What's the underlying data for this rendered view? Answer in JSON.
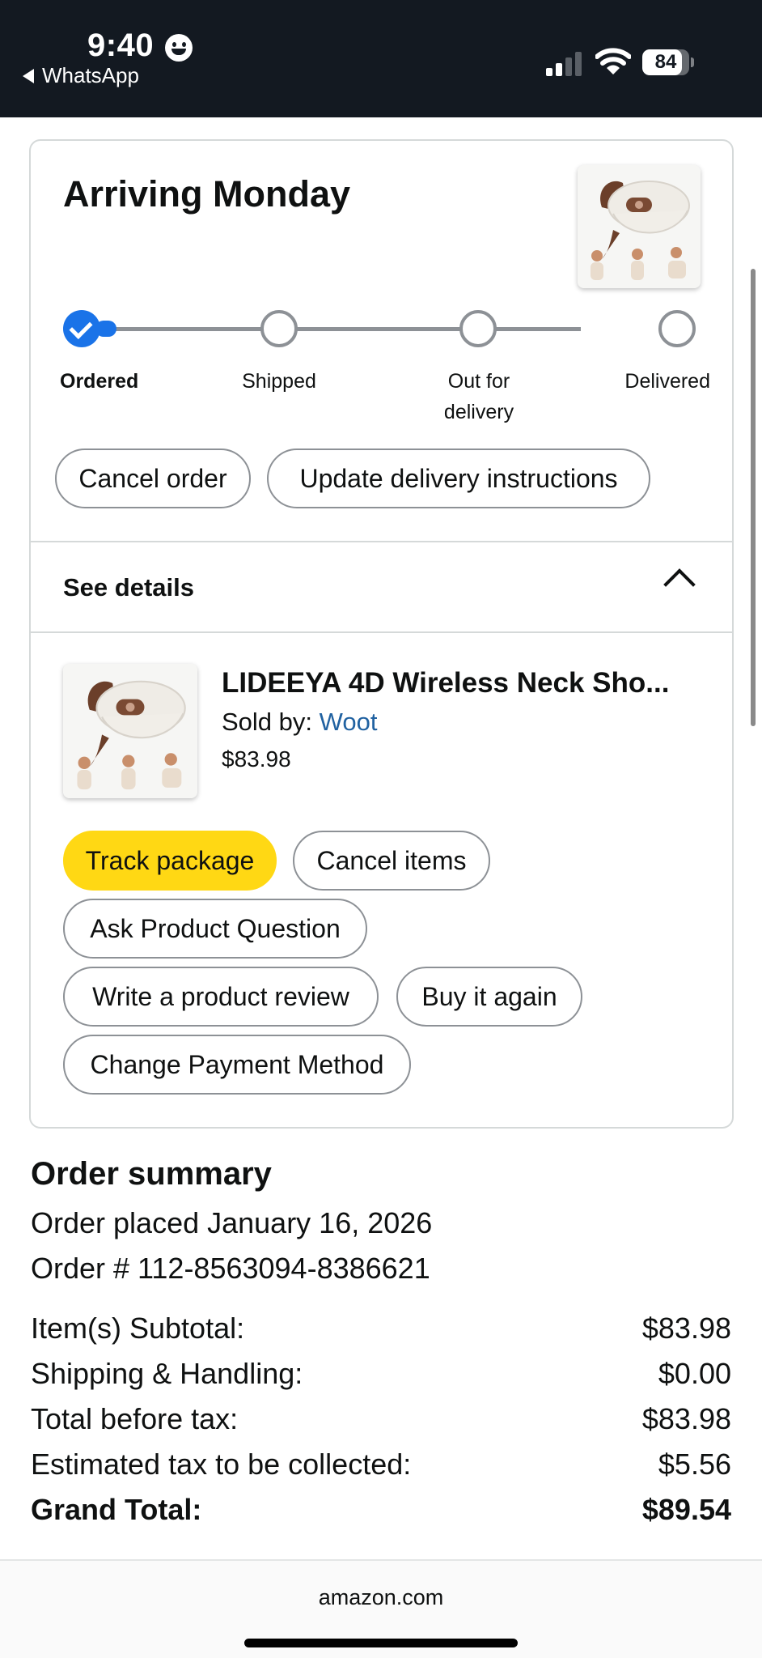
{
  "status_bar": {
    "time": "9:40",
    "back_app": "WhatsApp",
    "battery_percent": "84",
    "battery_level": 0.84,
    "signal_bars_active": 2,
    "icons": [
      "smiley-face-icon",
      "back-arrow-icon",
      "cellular-signal-icon",
      "wifi-icon",
      "battery-icon"
    ]
  },
  "shipment": {
    "title": "Arriving Monday",
    "steps": [
      {
        "label": "Ordered",
        "status": "complete"
      },
      {
        "label": "Shipped",
        "status": "pending"
      },
      {
        "label": "Out for delivery",
        "status": "pending"
      },
      {
        "label": "Delivered",
        "status": "pending"
      }
    ],
    "actions": {
      "cancel_order": "Cancel order",
      "update_instructions": "Update delivery instructions"
    },
    "details_toggle": "See details"
  },
  "item": {
    "title": "LIDEEYA 4D Wireless Neck Sho...",
    "sold_by_label": "Sold by:",
    "seller": "Woot",
    "price": "$83.98",
    "actions": {
      "track_package": "Track package",
      "cancel_items": "Cancel items",
      "ask_question": "Ask Product Question",
      "write_review": "Write a product review",
      "buy_again": "Buy it again",
      "change_payment": "Change Payment Method"
    }
  },
  "order_summary": {
    "title": "Order summary",
    "placed": "Order placed January 16, 2026",
    "order_number": "Order # 112-8563094-8386621",
    "rows": [
      {
        "label": "Item(s) Subtotal:",
        "value": "$83.98"
      },
      {
        "label": "Shipping & Handling:",
        "value": "$0.00"
      },
      {
        "label": "Total before tax:",
        "value": "$83.98"
      },
      {
        "label": "Estimated tax to be collected:",
        "value": "$5.56"
      },
      {
        "label": "Grand Total:",
        "value": "$89.54"
      }
    ]
  },
  "footer": {
    "domain": "amazon.com"
  },
  "colors": {
    "status_bar_bg": "#131921",
    "progress_blue": "#1a73e8",
    "primary_button_yellow": "#ffd814",
    "link_blue": "#2162a1",
    "border_gray": "#8d9196"
  }
}
